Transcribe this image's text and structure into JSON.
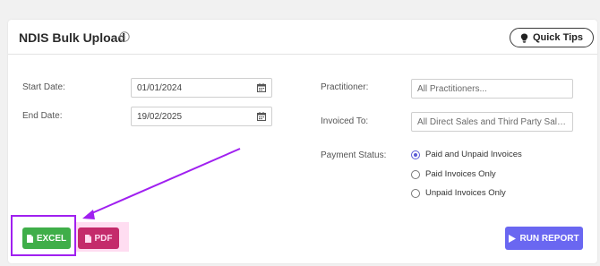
{
  "header": {
    "title": "NDIS Bulk Upload",
    "quick_tips_label": "Quick Tips"
  },
  "form": {
    "start_date": {
      "label": "Start Date:",
      "value": "01/01/2024"
    },
    "end_date": {
      "label": "End Date:",
      "value": "19/02/2025"
    },
    "practitioner": {
      "label": "Practitioner:",
      "value": "All Practitioners..."
    },
    "invoiced_to": {
      "label": "Invoiced To:",
      "value": "All Direct Sales and Third Party Sales.."
    },
    "payment_status": {
      "label": "Payment Status:",
      "options": [
        "Paid and Unpaid Invoices",
        "Paid Invoices Only",
        "Unpaid Invoices Only"
      ],
      "selected": "Paid and Unpaid Invoices"
    }
  },
  "actions": {
    "excel_label": "EXCEL",
    "pdf_label": "PDF",
    "run_label": "RUN REPORT"
  },
  "colors": {
    "excel": "#3fae49",
    "pdf": "#b0124d",
    "run": "#6a67f1",
    "annotation": "#a020f0"
  },
  "icons": [
    "info-icon",
    "lightbulb-icon",
    "calendar-icon",
    "file-icon",
    "play-icon"
  ]
}
